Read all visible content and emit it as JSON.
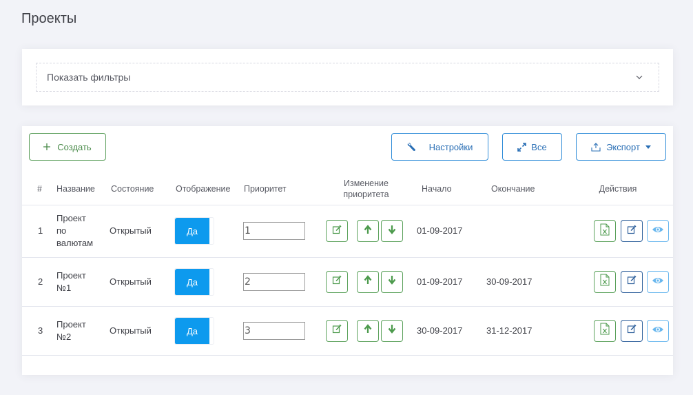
{
  "page": {
    "title": "Проекты"
  },
  "filters": {
    "label": "Показать фильтры"
  },
  "toolbar": {
    "create_label": "Создать",
    "settings_label": "Настройки",
    "all_label": "Все",
    "export_label": "Экспорт"
  },
  "table": {
    "headers": {
      "num": "#",
      "name": "Название",
      "state": "Состояние",
      "display": "Отображение",
      "priority": "Приоритет",
      "priority_change_1": "Изменение",
      "priority_change_2": "приоритета",
      "start": "Начало",
      "end": "Окончание",
      "actions": "Действия"
    },
    "rows": [
      {
        "num": "1",
        "name_lines": [
          "Проект",
          "по",
          "валютам"
        ],
        "state": "Открытый",
        "display": "Да",
        "priority": "1",
        "start": "01-09-2017",
        "end": ""
      },
      {
        "num": "2",
        "name_lines": [
          "Проект",
          "№1"
        ],
        "state": "Открытый",
        "display": "Да",
        "priority": "2",
        "start": "01-09-2017",
        "end": "30-09-2017"
      },
      {
        "num": "3",
        "name_lines": [
          "Проект",
          "№2"
        ],
        "state": "Открытый",
        "display": "Да",
        "priority": "3",
        "start": "30-09-2017",
        "end": "31-12-2017"
      }
    ]
  },
  "colors": {
    "accent_blue": "#0d9aee",
    "green": "#5aa15a",
    "navy": "#2d5f9b",
    "light_blue": "#69b7ee"
  },
  "icons": [
    "plus-icon",
    "wrench-icon",
    "expand-icon",
    "export-icon",
    "chevron-down-icon",
    "edit-icon",
    "arrow-up-icon",
    "arrow-down-icon",
    "excel-icon",
    "view-icon"
  ]
}
